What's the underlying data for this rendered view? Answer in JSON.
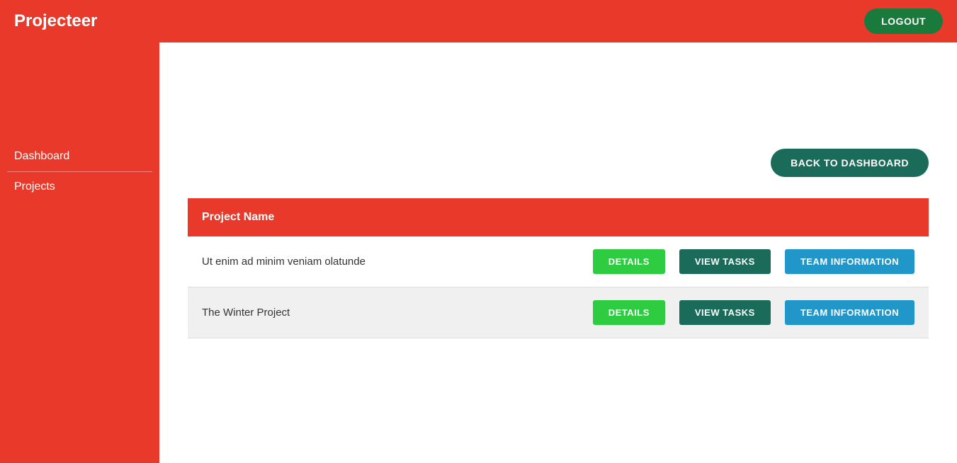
{
  "header": {
    "title": "Projecteer",
    "logout_label": "LOGOUT"
  },
  "sidebar": {
    "items": [
      {
        "label": "Dashboard",
        "name": "dashboard"
      },
      {
        "label": "Projects",
        "name": "projects"
      }
    ]
  },
  "content": {
    "back_button_label": "BACK TO DASHBOARD",
    "table": {
      "header": "Project Name",
      "rows": [
        {
          "name": "Ut enim ad minim veniam olatunde",
          "details_label": "DETAILS",
          "view_tasks_label": "VIEW TASKS",
          "team_info_label": "TEAM INFORMATION"
        },
        {
          "name": "The Winter Project",
          "details_label": "DETAILS",
          "view_tasks_label": "VIEW TASKS",
          "team_info_label": "TEAM INFORMATION"
        }
      ]
    }
  },
  "colors": {
    "header_bg": "#e8392a",
    "sidebar_bg": "#e8392a",
    "logout_btn": "#1a7a3c",
    "back_btn": "#1a6b5a",
    "details_btn": "#2ecc40",
    "view_tasks_btn": "#1a6b5a",
    "team_info_btn": "#2196c9"
  }
}
